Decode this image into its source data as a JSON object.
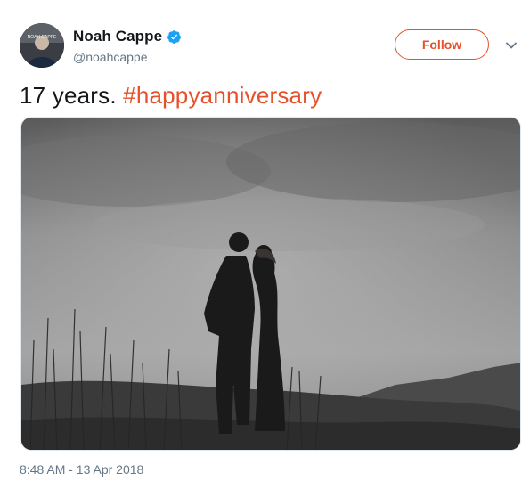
{
  "tweet": {
    "author": {
      "display_name": "Noah Cappe",
      "handle": "@noahcappe",
      "verified": true,
      "avatar_icon": "profile-photo",
      "avatar_overlay_text": "NOAH CAPPE"
    },
    "follow_label": "Follow",
    "menu_icon": "chevron-down-icon",
    "text_plain": "17 years. ",
    "hashtag": "#happyanniversary",
    "media_icon": "photo-couple-silhouette",
    "timestamp": "8:48 AM - 13 Apr 2018",
    "colors": {
      "accent": "#e5512a",
      "verified_blue": "#1da1f2",
      "secondary_text": "#657786",
      "primary_text": "#14171a"
    }
  }
}
